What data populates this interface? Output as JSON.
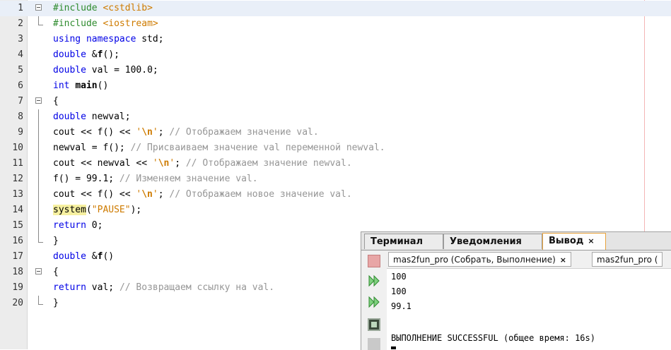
{
  "editor": {
    "lines": [
      {
        "n": "1",
        "parts": [
          {
            "t": "#include ",
            "c": "pp"
          },
          {
            "t": "<cstdlib>",
            "c": "inc"
          }
        ]
      },
      {
        "n": "2",
        "parts": [
          {
            "t": "#include ",
            "c": "pp"
          },
          {
            "t": "<iostream>",
            "c": "inc"
          }
        ]
      },
      {
        "n": "3",
        "parts": [
          {
            "t": "using namespace ",
            "c": "kw"
          },
          {
            "t": "std;",
            "c": ""
          }
        ]
      },
      {
        "n": "4",
        "parts": [
          {
            "t": "double ",
            "c": "kw"
          },
          {
            "t": "&",
            "c": ""
          },
          {
            "t": "f",
            "c": "bold"
          },
          {
            "t": "();",
            "c": ""
          }
        ]
      },
      {
        "n": "5",
        "parts": [
          {
            "t": "double ",
            "c": "kw"
          },
          {
            "t": "val = 100.0;",
            "c": ""
          }
        ]
      },
      {
        "n": "6",
        "parts": [
          {
            "t": "int ",
            "c": "kw"
          },
          {
            "t": "main",
            "c": "bold"
          },
          {
            "t": "()",
            "c": ""
          }
        ]
      },
      {
        "n": "7",
        "parts": [
          {
            "t": "{",
            "c": ""
          }
        ]
      },
      {
        "n": "8",
        "parts": [
          {
            "t": "double ",
            "c": "kw"
          },
          {
            "t": "newval;",
            "c": ""
          }
        ]
      },
      {
        "n": "9",
        "parts": [
          {
            "t": "cout << f() << ",
            "c": ""
          },
          {
            "t": "'",
            "c": "str"
          },
          {
            "t": "\\n",
            "c": "esc"
          },
          {
            "t": "'",
            "c": "str"
          },
          {
            "t": "; ",
            "c": ""
          },
          {
            "t": "// Отображаем значение val.",
            "c": "cmt"
          }
        ]
      },
      {
        "n": "10",
        "parts": [
          {
            "t": "newval = f(); ",
            "c": ""
          },
          {
            "t": "// Присваиваем значение val переменной newval.",
            "c": "cmt"
          }
        ]
      },
      {
        "n": "11",
        "parts": [
          {
            "t": "cout << newval << ",
            "c": ""
          },
          {
            "t": "'",
            "c": "str"
          },
          {
            "t": "\\n",
            "c": "esc"
          },
          {
            "t": "'",
            "c": "str"
          },
          {
            "t": "; ",
            "c": ""
          },
          {
            "t": "// Отображаем значение newval.",
            "c": "cmt"
          }
        ]
      },
      {
        "n": "12",
        "parts": [
          {
            "t": "f() = 99.1; ",
            "c": ""
          },
          {
            "t": "// Изменяем значение val.",
            "c": "cmt"
          }
        ]
      },
      {
        "n": "13",
        "parts": [
          {
            "t": "cout << f() << ",
            "c": ""
          },
          {
            "t": "'",
            "c": "str"
          },
          {
            "t": "\\n",
            "c": "esc"
          },
          {
            "t": "'",
            "c": "str"
          },
          {
            "t": "; ",
            "c": ""
          },
          {
            "t": "// Отображаем новое значение val.",
            "c": "cmt"
          }
        ]
      },
      {
        "n": "14",
        "parts": [
          {
            "t": "system",
            "c": "hl"
          },
          {
            "t": "(",
            "c": ""
          },
          {
            "t": "\"PAUSE\"",
            "c": "str"
          },
          {
            "t": ");",
            "c": ""
          }
        ]
      },
      {
        "n": "15",
        "parts": [
          {
            "t": "return ",
            "c": "kw"
          },
          {
            "t": "0;",
            "c": ""
          }
        ]
      },
      {
        "n": "16",
        "parts": [
          {
            "t": "}",
            "c": ""
          }
        ]
      },
      {
        "n": "17",
        "parts": [
          {
            "t": "double ",
            "c": "kw"
          },
          {
            "t": "&",
            "c": ""
          },
          {
            "t": "f",
            "c": "bold"
          },
          {
            "t": "()",
            "c": ""
          }
        ]
      },
      {
        "n": "18",
        "parts": [
          {
            "t": "{",
            "c": ""
          }
        ]
      },
      {
        "n": "19",
        "parts": [
          {
            "t": "return ",
            "c": "kw"
          },
          {
            "t": "val; ",
            "c": ""
          },
          {
            "t": "// Возвращаем ссылку на val.",
            "c": "cmt"
          }
        ]
      },
      {
        "n": "20",
        "parts": [
          {
            "t": "}",
            "c": ""
          }
        ]
      }
    ]
  },
  "output_panel": {
    "tabs": [
      {
        "label": "Терминал"
      },
      {
        "label": "Уведомления"
      },
      {
        "label": "Вывод",
        "close": "×"
      }
    ],
    "sub_tabs": [
      {
        "label": "mas2fun_pro (Собрать, Выполнение)",
        "close": "×"
      },
      {
        "label": "mas2fun_pro ("
      }
    ],
    "output_lines": [
      "100",
      "100",
      "99.1",
      "",
      "ВЫПОЛНЕНИЕ SUCCESSFUL (общее время: 16s)"
    ]
  }
}
